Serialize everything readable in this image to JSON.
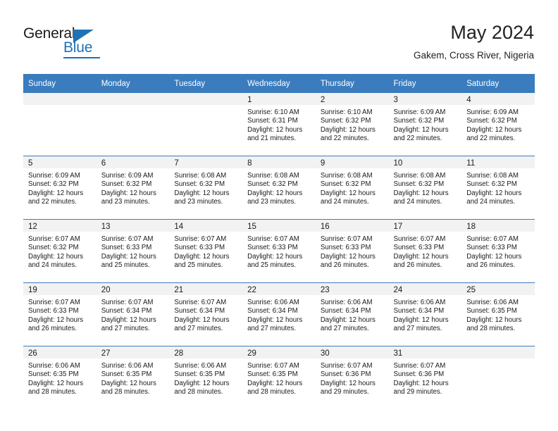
{
  "brand": {
    "name_part1": "General",
    "name_part2": "Blue",
    "triangle_icon": "triangle-icon",
    "accent_color": "#1f71b8"
  },
  "header": {
    "title": "May 2024",
    "subtitle": "Gakem, Cross River, Nigeria"
  },
  "calendar": {
    "header_bg": "#3a7cbe",
    "daynum_bg": "#f2f2f2",
    "weekday_headers": [
      "Sunday",
      "Monday",
      "Tuesday",
      "Wednesday",
      "Thursday",
      "Friday",
      "Saturday"
    ],
    "weeks": [
      [
        {
          "day": "",
          "sunrise": "",
          "sunset": "",
          "daylight_line1": "",
          "daylight_line2": ""
        },
        {
          "day": "",
          "sunrise": "",
          "sunset": "",
          "daylight_line1": "",
          "daylight_line2": ""
        },
        {
          "day": "",
          "sunrise": "",
          "sunset": "",
          "daylight_line1": "",
          "daylight_line2": ""
        },
        {
          "day": "1",
          "sunrise": "Sunrise: 6:10 AM",
          "sunset": "Sunset: 6:31 PM",
          "daylight_line1": "Daylight: 12 hours",
          "daylight_line2": "and 21 minutes."
        },
        {
          "day": "2",
          "sunrise": "Sunrise: 6:10 AM",
          "sunset": "Sunset: 6:32 PM",
          "daylight_line1": "Daylight: 12 hours",
          "daylight_line2": "and 22 minutes."
        },
        {
          "day": "3",
          "sunrise": "Sunrise: 6:09 AM",
          "sunset": "Sunset: 6:32 PM",
          "daylight_line1": "Daylight: 12 hours",
          "daylight_line2": "and 22 minutes."
        },
        {
          "day": "4",
          "sunrise": "Sunrise: 6:09 AM",
          "sunset": "Sunset: 6:32 PM",
          "daylight_line1": "Daylight: 12 hours",
          "daylight_line2": "and 22 minutes."
        }
      ],
      [
        {
          "day": "5",
          "sunrise": "Sunrise: 6:09 AM",
          "sunset": "Sunset: 6:32 PM",
          "daylight_line1": "Daylight: 12 hours",
          "daylight_line2": "and 22 minutes."
        },
        {
          "day": "6",
          "sunrise": "Sunrise: 6:09 AM",
          "sunset": "Sunset: 6:32 PM",
          "daylight_line1": "Daylight: 12 hours",
          "daylight_line2": "and 23 minutes."
        },
        {
          "day": "7",
          "sunrise": "Sunrise: 6:08 AM",
          "sunset": "Sunset: 6:32 PM",
          "daylight_line1": "Daylight: 12 hours",
          "daylight_line2": "and 23 minutes."
        },
        {
          "day": "8",
          "sunrise": "Sunrise: 6:08 AM",
          "sunset": "Sunset: 6:32 PM",
          "daylight_line1": "Daylight: 12 hours",
          "daylight_line2": "and 23 minutes."
        },
        {
          "day": "9",
          "sunrise": "Sunrise: 6:08 AM",
          "sunset": "Sunset: 6:32 PM",
          "daylight_line1": "Daylight: 12 hours",
          "daylight_line2": "and 24 minutes."
        },
        {
          "day": "10",
          "sunrise": "Sunrise: 6:08 AM",
          "sunset": "Sunset: 6:32 PM",
          "daylight_line1": "Daylight: 12 hours",
          "daylight_line2": "and 24 minutes."
        },
        {
          "day": "11",
          "sunrise": "Sunrise: 6:08 AM",
          "sunset": "Sunset: 6:32 PM",
          "daylight_line1": "Daylight: 12 hours",
          "daylight_line2": "and 24 minutes."
        }
      ],
      [
        {
          "day": "12",
          "sunrise": "Sunrise: 6:07 AM",
          "sunset": "Sunset: 6:32 PM",
          "daylight_line1": "Daylight: 12 hours",
          "daylight_line2": "and 24 minutes."
        },
        {
          "day": "13",
          "sunrise": "Sunrise: 6:07 AM",
          "sunset": "Sunset: 6:33 PM",
          "daylight_line1": "Daylight: 12 hours",
          "daylight_line2": "and 25 minutes."
        },
        {
          "day": "14",
          "sunrise": "Sunrise: 6:07 AM",
          "sunset": "Sunset: 6:33 PM",
          "daylight_line1": "Daylight: 12 hours",
          "daylight_line2": "and 25 minutes."
        },
        {
          "day": "15",
          "sunrise": "Sunrise: 6:07 AM",
          "sunset": "Sunset: 6:33 PM",
          "daylight_line1": "Daylight: 12 hours",
          "daylight_line2": "and 25 minutes."
        },
        {
          "day": "16",
          "sunrise": "Sunrise: 6:07 AM",
          "sunset": "Sunset: 6:33 PM",
          "daylight_line1": "Daylight: 12 hours",
          "daylight_line2": "and 26 minutes."
        },
        {
          "day": "17",
          "sunrise": "Sunrise: 6:07 AM",
          "sunset": "Sunset: 6:33 PM",
          "daylight_line1": "Daylight: 12 hours",
          "daylight_line2": "and 26 minutes."
        },
        {
          "day": "18",
          "sunrise": "Sunrise: 6:07 AM",
          "sunset": "Sunset: 6:33 PM",
          "daylight_line1": "Daylight: 12 hours",
          "daylight_line2": "and 26 minutes."
        }
      ],
      [
        {
          "day": "19",
          "sunrise": "Sunrise: 6:07 AM",
          "sunset": "Sunset: 6:33 PM",
          "daylight_line1": "Daylight: 12 hours",
          "daylight_line2": "and 26 minutes."
        },
        {
          "day": "20",
          "sunrise": "Sunrise: 6:07 AM",
          "sunset": "Sunset: 6:34 PM",
          "daylight_line1": "Daylight: 12 hours",
          "daylight_line2": "and 27 minutes."
        },
        {
          "day": "21",
          "sunrise": "Sunrise: 6:07 AM",
          "sunset": "Sunset: 6:34 PM",
          "daylight_line1": "Daylight: 12 hours",
          "daylight_line2": "and 27 minutes."
        },
        {
          "day": "22",
          "sunrise": "Sunrise: 6:06 AM",
          "sunset": "Sunset: 6:34 PM",
          "daylight_line1": "Daylight: 12 hours",
          "daylight_line2": "and 27 minutes."
        },
        {
          "day": "23",
          "sunrise": "Sunrise: 6:06 AM",
          "sunset": "Sunset: 6:34 PM",
          "daylight_line1": "Daylight: 12 hours",
          "daylight_line2": "and 27 minutes."
        },
        {
          "day": "24",
          "sunrise": "Sunrise: 6:06 AM",
          "sunset": "Sunset: 6:34 PM",
          "daylight_line1": "Daylight: 12 hours",
          "daylight_line2": "and 27 minutes."
        },
        {
          "day": "25",
          "sunrise": "Sunrise: 6:06 AM",
          "sunset": "Sunset: 6:35 PM",
          "daylight_line1": "Daylight: 12 hours",
          "daylight_line2": "and 28 minutes."
        }
      ],
      [
        {
          "day": "26",
          "sunrise": "Sunrise: 6:06 AM",
          "sunset": "Sunset: 6:35 PM",
          "daylight_line1": "Daylight: 12 hours",
          "daylight_line2": "and 28 minutes."
        },
        {
          "day": "27",
          "sunrise": "Sunrise: 6:06 AM",
          "sunset": "Sunset: 6:35 PM",
          "daylight_line1": "Daylight: 12 hours",
          "daylight_line2": "and 28 minutes."
        },
        {
          "day": "28",
          "sunrise": "Sunrise: 6:06 AM",
          "sunset": "Sunset: 6:35 PM",
          "daylight_line1": "Daylight: 12 hours",
          "daylight_line2": "and 28 minutes."
        },
        {
          "day": "29",
          "sunrise": "Sunrise: 6:07 AM",
          "sunset": "Sunset: 6:35 PM",
          "daylight_line1": "Daylight: 12 hours",
          "daylight_line2": "and 28 minutes."
        },
        {
          "day": "30",
          "sunrise": "Sunrise: 6:07 AM",
          "sunset": "Sunset: 6:36 PM",
          "daylight_line1": "Daylight: 12 hours",
          "daylight_line2": "and 29 minutes."
        },
        {
          "day": "31",
          "sunrise": "Sunrise: 6:07 AM",
          "sunset": "Sunset: 6:36 PM",
          "daylight_line1": "Daylight: 12 hours",
          "daylight_line2": "and 29 minutes."
        },
        {
          "day": "",
          "sunrise": "",
          "sunset": "",
          "daylight_line1": "",
          "daylight_line2": ""
        }
      ]
    ]
  }
}
